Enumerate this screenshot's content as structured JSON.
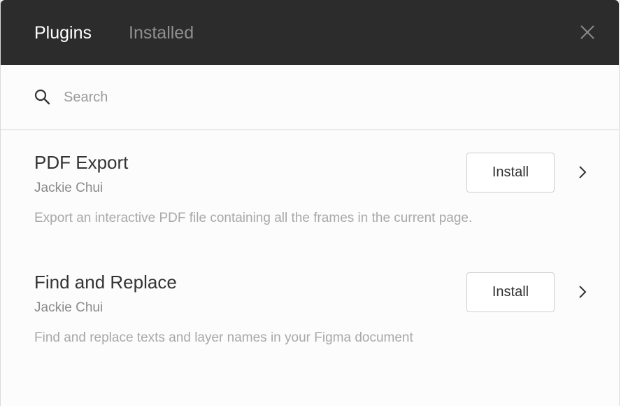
{
  "header": {
    "tabs": [
      {
        "label": "Plugins",
        "active": true
      },
      {
        "label": "Installed",
        "active": false
      }
    ],
    "close_icon": "close-icon"
  },
  "search": {
    "placeholder": "Search",
    "value": "",
    "icon": "search-icon"
  },
  "plugins": [
    {
      "name": "PDF Export",
      "author": "Jackie Chui",
      "description": "Export an interactive PDF file containing all the frames in the current page.",
      "button_label": "Install"
    },
    {
      "name": "Find and Replace",
      "author": "Jackie Chui",
      "description": "Find and replace texts and layer names in your Figma document",
      "button_label": "Install"
    }
  ],
  "colors": {
    "header_bg": "#2c2c2c",
    "active_tab": "#ffffff",
    "inactive_tab": "#8f8f8f"
  }
}
